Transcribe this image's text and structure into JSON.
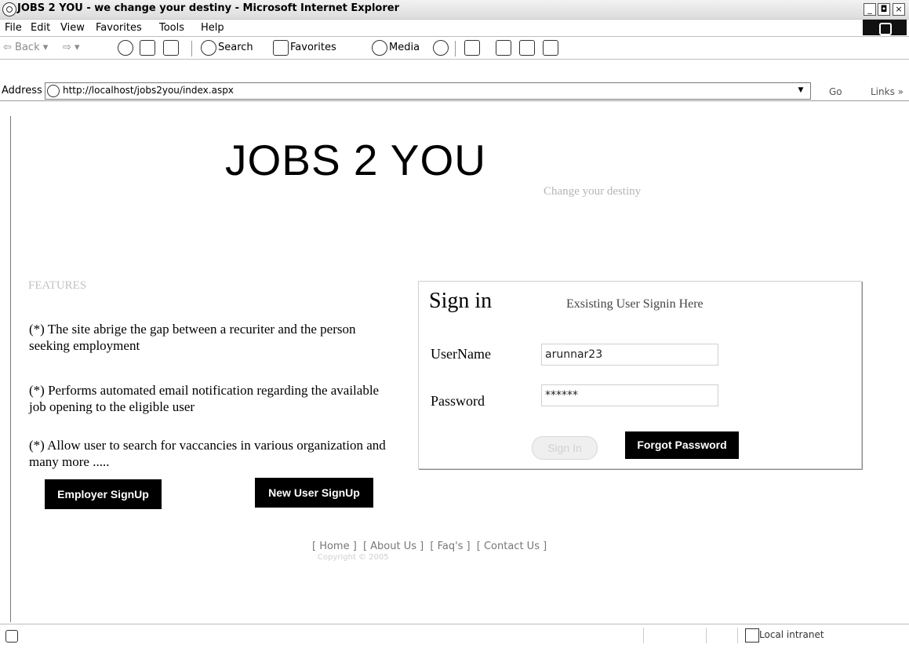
{
  "window": {
    "title": "JOBS 2 YOU - we change your destiny - Microsoft Internet Explorer",
    "minimize": "_",
    "maximize": "◘",
    "close": "×"
  },
  "menu": [
    "File",
    "Edit",
    "View",
    "Favorites",
    "Tools",
    "Help"
  ],
  "toolbar": {
    "back": "Back",
    "search": "Search",
    "favorites": "Favorites",
    "media": "Media"
  },
  "address": {
    "label": "Address",
    "url": "http://localhost/jobs2you/index.aspx",
    "go": "Go",
    "links": "Links »"
  },
  "site": {
    "title": "JOBS 2 YOU",
    "tagline": "Change your destiny"
  },
  "features": {
    "heading": "FEATURES",
    "items": [
      "(*)  The site abrige the gap between a recuriter and the person seeking employment",
      "(*) Performs automated email notification regarding the available job opening to the eligible user",
      "(*) Allow user to search for vaccancies in  various organization and many more ....."
    ]
  },
  "buttons": {
    "employer_signup": "Employer SignUp",
    "new_user_signup": "New User SignUp",
    "sign_in": "Sign In",
    "forgot_password": "Forgot Password"
  },
  "signin": {
    "heading": "Sign in",
    "subheading": "Exsisting User Signin Here",
    "username_label": "UserName",
    "username_value": "arunnar23",
    "password_label": "Password",
    "password_value": "******"
  },
  "footer": {
    "links": [
      "[ Home ]",
      "[ About Us ]",
      "[ Faq's ]",
      "[ Contact Us ]"
    ],
    "copyright": "Copyright © 2005"
  },
  "status": {
    "zone": "Local intranet"
  }
}
